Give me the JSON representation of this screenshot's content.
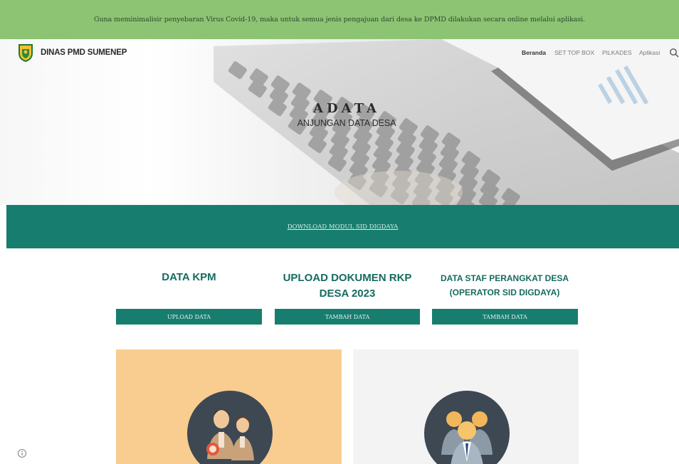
{
  "announcement": "Guna meminimalisir penyebaran Virus Covid-19, maka untuk semua jenis pengajuan dari desa ke DPMD dilakukan secara online melalui aplikasi.",
  "brand": {
    "name": "DINAS PMD SUMENEP",
    "logo_icon": "regency-crest-icon"
  },
  "nav": {
    "items": [
      {
        "label": "Beranda",
        "active": true
      },
      {
        "label": "SET TOP BOX",
        "active": false
      },
      {
        "label": "PILKADES",
        "active": false
      },
      {
        "label": "Aplikasi",
        "active": false
      }
    ],
    "search_icon": "search-icon"
  },
  "hero": {
    "title": "ADATA",
    "subtitle": "ANJUNGAN DATA DESA"
  },
  "download_band": {
    "link_label": "DOWNLOAD MODUL SID DIGDAYA"
  },
  "sections": [
    {
      "title": "DATA KPM",
      "button": "UPLOAD DATA"
    },
    {
      "title": "UPLOAD DOKUMEN RKP DESA 2023",
      "button": "TAMBAH DATA"
    },
    {
      "title": "DATA STAF PERANGKAT DESA (OPERATOR SID DIGDAYA)",
      "button": "TAMBAH DATA"
    }
  ],
  "cards": [
    {
      "icon": "civil-servants-icon",
      "background": "#f9cd8f"
    },
    {
      "icon": "business-team-icon",
      "background": "#f3f3f3"
    }
  ],
  "colors": {
    "announcement": "#8cc474",
    "accent": "#177d6f",
    "title": "#156b60"
  },
  "footer": {
    "info_icon": "info-icon"
  }
}
